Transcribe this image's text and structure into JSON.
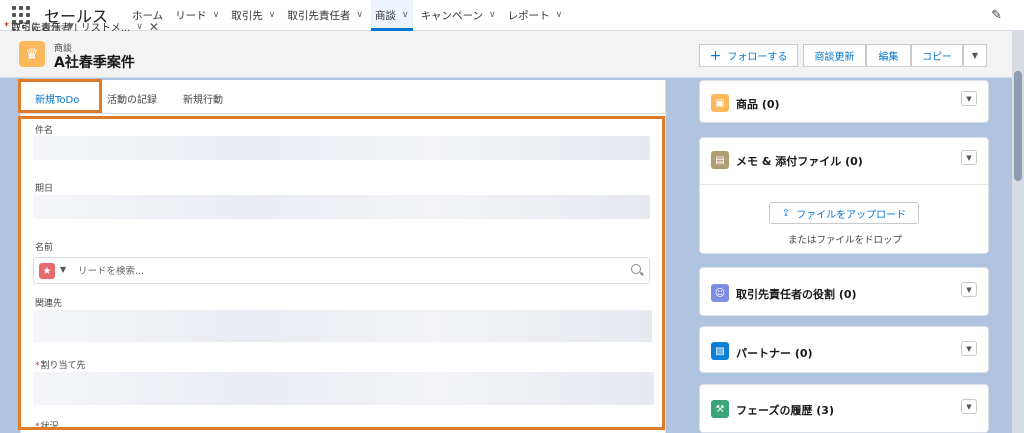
{
  "app": {
    "name": "セールス"
  },
  "nav": {
    "items": [
      {
        "label": "ホーム",
        "chevron": false
      },
      {
        "label": "リード",
        "chevron": true
      },
      {
        "label": "取引先",
        "chevron": true
      },
      {
        "label": "取引先責任者",
        "chevron": true
      },
      {
        "label": "商談",
        "chevron": true,
        "active": true
      },
      {
        "label": "キャンペーン",
        "chevron": true
      },
      {
        "label": "レポート",
        "chevron": true
      }
    ],
    "open_tab": "取引先責任者 | リストメ...",
    "more": "さらに表示"
  },
  "record": {
    "type": "商談",
    "title": "A社春季案件",
    "buttons": {
      "follow": "フォローする",
      "update": "商談更新",
      "edit": "編集",
      "copy": "コピー"
    }
  },
  "activity": {
    "tabs": [
      {
        "label": "新規ToDo",
        "active": true
      },
      {
        "label": "活動の記録"
      },
      {
        "label": "新規行動"
      }
    ],
    "fields": {
      "subject_label": "件名",
      "due_date_label": "期日",
      "name_label": "名前",
      "name_placeholder": "リードを検索...",
      "related_label": "関連先",
      "assigned_label": "割り当て先",
      "status_label": "状況"
    }
  },
  "sidebar": {
    "products": "商品 (0)",
    "notes": "メモ & 添付ファイル (0)",
    "upload": "ファイルをアップロード",
    "drop": "またはファイルをドロップ",
    "contact_roles": "取引先責任者の役割 (0)",
    "partners": "パートナー (0)",
    "stage_history": "フェーズの履歴 (3)"
  },
  "colors": {
    "brand": "#0176d3",
    "highlight": "#e07b2a",
    "opportunity_icon": "#fcb95b",
    "products_icon": "#fcb95b",
    "notes_icon": "#b19b72",
    "roles_icon": "#7f8de1",
    "partners_icon": "#0b80d6",
    "history_icon": "#3ba57a"
  }
}
